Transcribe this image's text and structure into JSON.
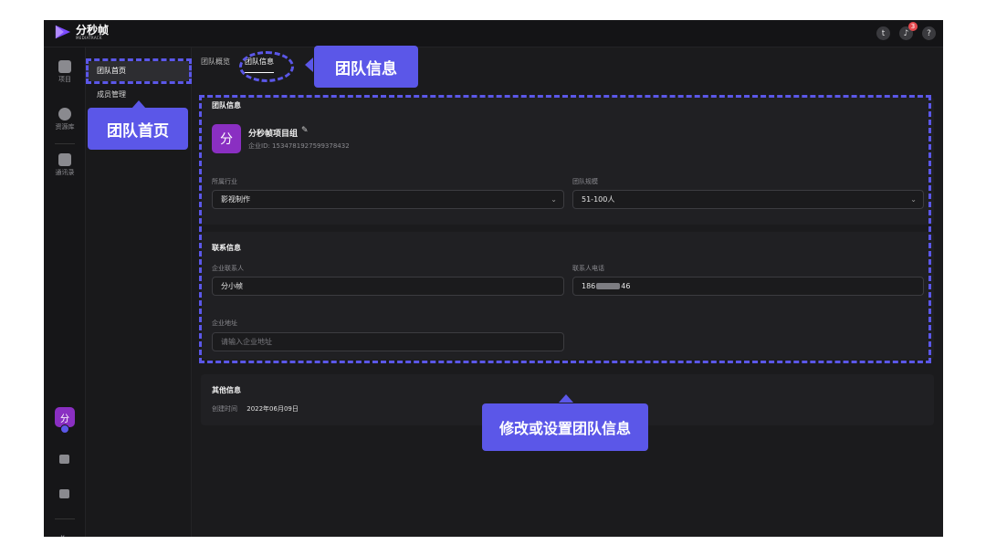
{
  "brand": {
    "name": "分秒帧",
    "sub": "MEDIATRACK",
    "color": "#8a2fc2"
  },
  "top_icons": [
    {
      "icon": "team-switch-icon",
      "glyph": "t"
    },
    {
      "icon": "bell-icon",
      "glyph": "♪",
      "badge": "3"
    },
    {
      "icon": "help-icon",
      "glyph": "?"
    }
  ],
  "rail": {
    "items": [
      {
        "icon": "project-icon",
        "label": "项目"
      },
      {
        "icon": "asset-library-icon",
        "label": "资源库"
      },
      {
        "icon": "contacts-icon",
        "label": "通讯录"
      }
    ],
    "avatar": "分",
    "collapse_glyph": "⇤"
  },
  "subnav": {
    "items": [
      "团队首页",
      "成员管理"
    ],
    "active": 0
  },
  "tabs": {
    "items": [
      "团队概览",
      "团队信息"
    ],
    "active": 1
  },
  "team_info": {
    "section_title": "团队信息",
    "logo_char": "分",
    "team_name": "分秒帧项目组",
    "edit_glyph": "✎",
    "enterprise_id": "企业ID: 1534781927599378432",
    "industry_label": "所属行业",
    "industry_value": "影视制作",
    "size_label": "团队规模",
    "size_value": "51-100人"
  },
  "contact_info": {
    "section_title": "联系信息",
    "contact_label": "企业联系人",
    "contact_value": "分小帧",
    "phone_label": "联系人电话",
    "phone_prefix": "186",
    "phone_suffix": "46",
    "address_label": "企业地址",
    "address_placeholder": "请输入企业地址"
  },
  "other_info": {
    "section_title": "其他信息",
    "created_label": "创建时间",
    "created_value": "2022年06月09日"
  },
  "annotations": {
    "team_home": "团队首页",
    "team_info": "团队信息",
    "modify": "修改或设置团队信息",
    "color": "#5b57e8"
  }
}
